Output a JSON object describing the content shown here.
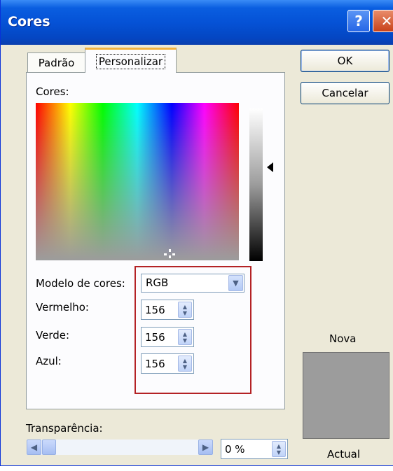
{
  "window": {
    "title": "Cores",
    "help_label": "?",
    "close_label": "✕"
  },
  "tabs": [
    {
      "label": "Padrão",
      "selected": false
    },
    {
      "label": "Personalizar",
      "selected": true
    }
  ],
  "custom": {
    "colors_label": "Cores:",
    "model_label": "Modelo de cores:",
    "model_value": "RGB",
    "red_label": "Vermelho:",
    "red_value": "156",
    "green_label": "Verde:",
    "green_value": "156",
    "blue_label": "Azul:",
    "blue_value": "156"
  },
  "transparency": {
    "label": "Transparência:",
    "value": "0 %"
  },
  "buttons": {
    "ok": "OK",
    "cancel": "Cancelar"
  },
  "preview": {
    "new_label": "Nova",
    "current_label": "Actual",
    "color": "#9c9c9c"
  },
  "icons": {
    "dropdown": "chevron-down-icon",
    "spinner": "spinner-arrows-icon",
    "scroll_left": "arrow-left-icon",
    "scroll_right": "arrow-right-icon",
    "luminance_marker": "triangle-left-icon"
  },
  "colors": {
    "title_bar": "#0552d6",
    "highlight_box": "#b42225",
    "dialog_bg": "#ece9d8"
  }
}
